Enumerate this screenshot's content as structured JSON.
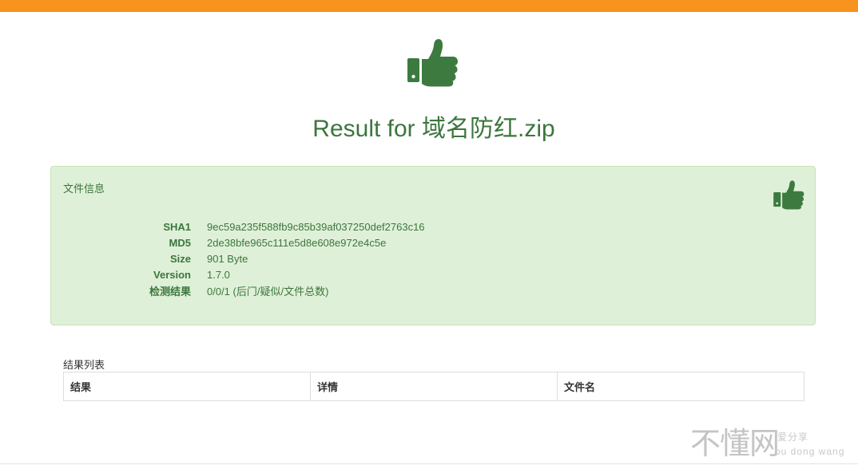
{
  "header": {
    "accent_color": "#f7931e"
  },
  "hero": {
    "icon": "thumbs-up-icon",
    "title": "Result for 域名防红.zip",
    "title_color": "#3c763d"
  },
  "file_info": {
    "title": "文件信息",
    "icon": "thumbs-up-icon",
    "background": "#dff0d8",
    "rows": [
      {
        "label": "SHA1",
        "value": "9ec59a235f588fb9c85b39af037250def2763c16"
      },
      {
        "label": "MD5",
        "value": "2de38bfe965c111e5d8e608e972e4c5e"
      },
      {
        "label": "Size",
        "value": "901 Byte"
      },
      {
        "label": "Version",
        "value": "1.7.0"
      },
      {
        "label": "检测结果",
        "value": "0/0/1 (后门/疑似/文件总数)"
      }
    ]
  },
  "results": {
    "label": "结果列表",
    "columns": [
      "结果",
      "详情",
      "文件名"
    ]
  },
  "watermark": {
    "main": "不懂网",
    "sub1": "爱分享",
    "sub2": "bu dong wang"
  }
}
